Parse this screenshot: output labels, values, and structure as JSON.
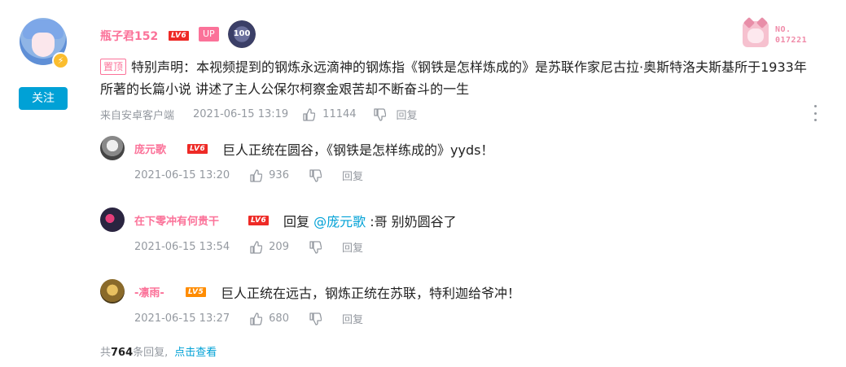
{
  "main": {
    "username": "瓶子君152",
    "level": "LV6",
    "up_tag": "UP",
    "medal_text": "100",
    "fan_no_label": "NO.",
    "fan_no_value": "017221",
    "follow_label": "关注",
    "pin_label": "置顶",
    "text": "特别声明：本视频提到的钢炼永远滴神的钢炼指《钢铁是怎样炼成的》是苏联作家尼古拉·奥斯特洛夫斯基所于1933年所著的长篇小说 讲述了主人公保尔柯察金艰苦却不断奋斗的一生",
    "source": "来自安卓客户端",
    "time": "2021-06-15 13:19",
    "likes": "11144",
    "reply_label": "回复"
  },
  "replies": [
    {
      "username": "庞元歌",
      "level": "LV6",
      "prefix": "",
      "mention": "",
      "text": "巨人正统在圆谷，《钢铁是怎样练成的》yyds！",
      "time": "2021-06-15 13:20",
      "likes": "936",
      "reply_label": "回复"
    },
    {
      "username": "在下零冲有何贵干",
      "level": "LV6",
      "prefix": "回复 ",
      "mention": "@庞元歌",
      "text": " :哥 别奶圆谷了",
      "time": "2021-06-15 13:54",
      "likes": "209",
      "reply_label": "回复"
    },
    {
      "username": "-凛雨-",
      "level": "LV5",
      "prefix": "",
      "mention": "",
      "text": "巨人正统在远古，钢炼正统在苏联，特利迦给爷冲！",
      "time": "2021-06-15 13:27",
      "likes": "680",
      "reply_label": "回复"
    }
  ],
  "footer": {
    "prefix": "共",
    "count": "764",
    "suffix": "条回复,",
    "view_label": "点击查看"
  },
  "colors": {
    "accent_blue": "#00a1d6",
    "name_pink": "#fb7299",
    "meta_gray": "#9499a0",
    "lv6_red": "#ee2a26",
    "lv5_orange": "#ff8c00"
  }
}
